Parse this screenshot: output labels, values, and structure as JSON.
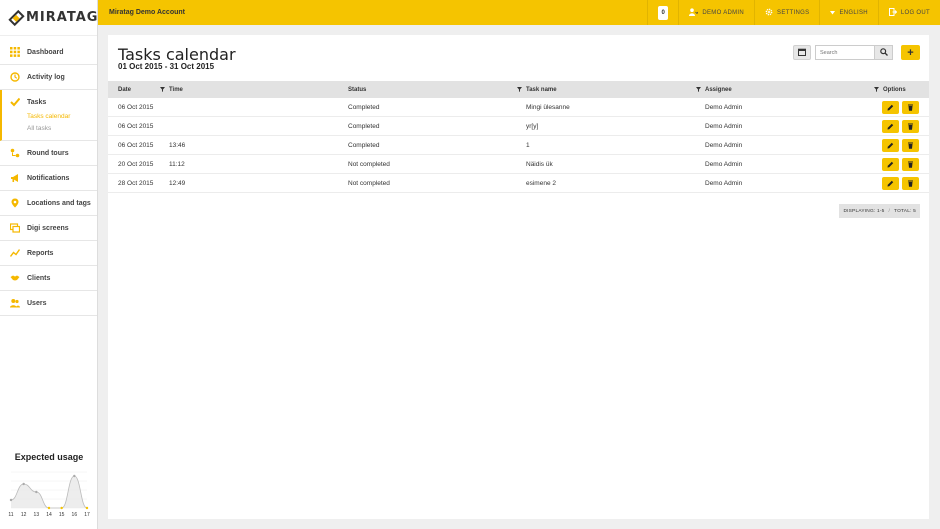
{
  "app": {
    "logo": "MIRATAG",
    "account": "Miratag Demo Account"
  },
  "topbar": {
    "notifications_count": "0",
    "user": "DEMO ADMIN",
    "settings": "SETTINGS",
    "language": "ENGLISH",
    "logout": "LOG OUT"
  },
  "sidebar": {
    "items": [
      {
        "label": "Dashboard",
        "icon": "grid-icon"
      },
      {
        "label": "Activity log",
        "icon": "history-icon"
      },
      {
        "label": "Tasks",
        "icon": "check-icon"
      },
      {
        "label": "Round tours",
        "icon": "route-icon"
      },
      {
        "label": "Notifications",
        "icon": "megaphone-icon"
      },
      {
        "label": "Locations and tags",
        "icon": "location-pin-icon"
      },
      {
        "label": "Digi screens",
        "icon": "screens-icon"
      },
      {
        "label": "Reports",
        "icon": "chart-line-icon"
      },
      {
        "label": "Clients",
        "icon": "handshake-icon"
      },
      {
        "label": "Users",
        "icon": "users-icon"
      }
    ],
    "tasks_sub": [
      "Tasks calendar",
      "All tasks"
    ]
  },
  "usage": {
    "title": "Expected usage",
    "x_labels": [
      "11",
      "12",
      "13",
      "14",
      "15",
      "16",
      "17"
    ],
    "values": [
      1,
      3,
      2,
      0,
      0,
      4,
      0
    ]
  },
  "page": {
    "title": "Tasks calendar",
    "date_range": "01 Oct 2015 - 31 Oct 2015",
    "search_placeholder": "Search",
    "add_label": "+"
  },
  "table": {
    "headers": {
      "date": "Date",
      "time": "Time",
      "status": "Status",
      "task": "Task name",
      "assignee": "Assignee",
      "options": "Options"
    },
    "rows": [
      {
        "date": "06 Oct 2015",
        "time": "",
        "status": "Completed",
        "task": "Mingi ülesanne",
        "assignee": "Demo Admin"
      },
      {
        "date": "06 Oct 2015",
        "time": "",
        "status": "Completed",
        "task": "yr[y]",
        "assignee": "Demo Admin"
      },
      {
        "date": "06 Oct 2015",
        "time": "13:46",
        "status": "Completed",
        "task": "1",
        "assignee": "Demo Admin"
      },
      {
        "date": "20 Oct 2015",
        "time": "11:12",
        "status": "Not completed",
        "task": "Näidis ük",
        "assignee": "Demo Admin"
      },
      {
        "date": "28 Oct 2015",
        "time": "12:49",
        "status": "Not completed",
        "task": "esimene 2",
        "assignee": "Demo Admin"
      }
    ]
  },
  "pager": {
    "displaying": "DISPLAYING: 1-5",
    "total": "TOTAL: 5"
  },
  "colors": {
    "accent": "#f5c400",
    "sidebar_accent": "#f5b800"
  }
}
